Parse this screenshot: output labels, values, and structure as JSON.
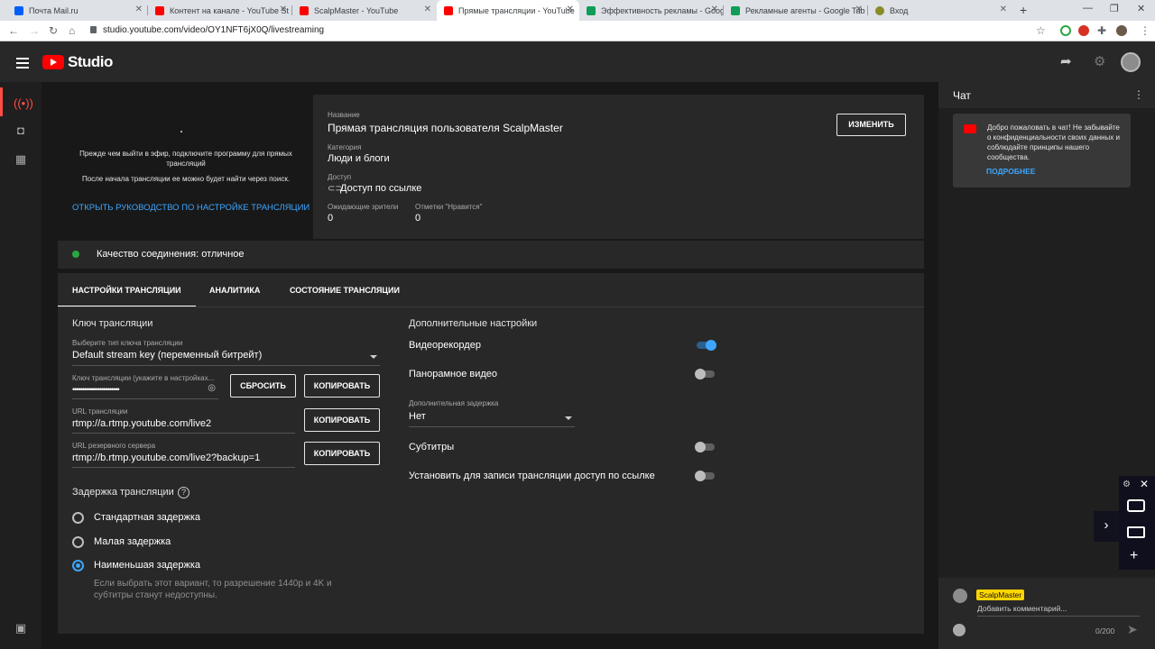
{
  "browser": {
    "tabs": [
      {
        "title": "Почта Mail.ru",
        "color": "#005ff9"
      },
      {
        "title": "Контент на канале - YouTube St",
        "color": "#ff0000"
      },
      {
        "title": "ScalpMaster - YouTube",
        "color": "#ff0000"
      },
      {
        "title": "Прямые трансляции - YouTube",
        "color": "#ff0000"
      },
      {
        "title": "Эффективность рекламы - Goog",
        "color": "#0f9d58"
      },
      {
        "title": "Рекламные агенты - Google Tab",
        "color": "#0f9d58"
      },
      {
        "title": "Вход",
        "color": "#8a8a2a"
      }
    ],
    "url": "studio.youtube.com/video/OY1NFT6jX0Q/livestreaming"
  },
  "header": {
    "brand": "Studio"
  },
  "preview": {
    "hint1": "Прежде чем выйти в эфир, подключите программу для прямых трансляций",
    "hint2": "После начала трансляции ее можно будет найти через поиск.",
    "guide_link": "ОТКРЫТЬ РУКОВОДСТВО ПО НАСТРОЙКЕ ТРАНСЛЯЦИИ"
  },
  "meta": {
    "title_label": "Название",
    "title": "Прямая трансляция пользователя ScalpMaster",
    "category_label": "Категория",
    "category": "Люди и блоги",
    "access_label": "Доступ",
    "access": "Доступ по ссылке",
    "waiting_label": "Ожидающие зрители",
    "waiting": "0",
    "likes_label": "Отметки \"Нравится\"",
    "likes": "0",
    "edit_button": "ИЗМЕНИТЬ"
  },
  "quality": {
    "text": "Качество соединения: отличное",
    "status_color": "#2ba640"
  },
  "tabs": {
    "settings": "НАСТРОЙКИ ТРАНСЛЯЦИИ",
    "analytics": "АНАЛИТИКА",
    "status": "СОСТОЯНИЕ ТРАНСЛЯЦИИ"
  },
  "stream_key": {
    "section_title": "Ключ трансляции",
    "type_label": "Выберите тип ключа трансляции",
    "type_value": "Default stream key (переменный битрейт)",
    "key_label": "Ключ трансляции (укажите в настройках...",
    "key_value": "••••••••••••••••••••••••",
    "reset_button": "СБРОСИТЬ",
    "copy_button": "КОПИРОВАТЬ",
    "url_label": "URL трансляции",
    "url_value": "rtmp://a.rtmp.youtube.com/live2",
    "backup_label": "URL резервного сервера",
    "backup_value": "rtmp://b.rtmp.youtube.com/live2?backup=1"
  },
  "latency": {
    "title": "Задержка трансляции",
    "options": [
      "Стандартная задержка",
      "Малая задержка",
      "Наименьшая задержка"
    ],
    "selected_index": 2,
    "note": "Если выбрать этот вариант, то разрешение 1440p и 4K и субтитры станут недоступны."
  },
  "additional": {
    "title": "Дополнительные настройки",
    "dvr": "Видеорекордер",
    "dvr_on": true,
    "panorama": "Панорамное видео",
    "panorama_on": false,
    "delay_label": "Дополнительная задержка",
    "delay_value": "Нет",
    "subtitles": "Субтитры",
    "subtitles_on": false,
    "unlisted_record": "Установить для записи трансляции доступ по ссылке",
    "unlisted_on": false
  },
  "chat": {
    "title": "Чат",
    "welcome": "Добро пожаловать в чат! Не забывайте о конфиденциальности своих данных и соблюдайте принципы нашего сообщества.",
    "more_link": "ПОДРОБНЕЕ",
    "author": "ScalpMaster",
    "input_placeholder": "Добавить комментарий...",
    "counter": "0/200"
  },
  "colors": {
    "accent": "#3ea6ff",
    "brand": "#ff0000",
    "author_badge": "#ffd600"
  }
}
